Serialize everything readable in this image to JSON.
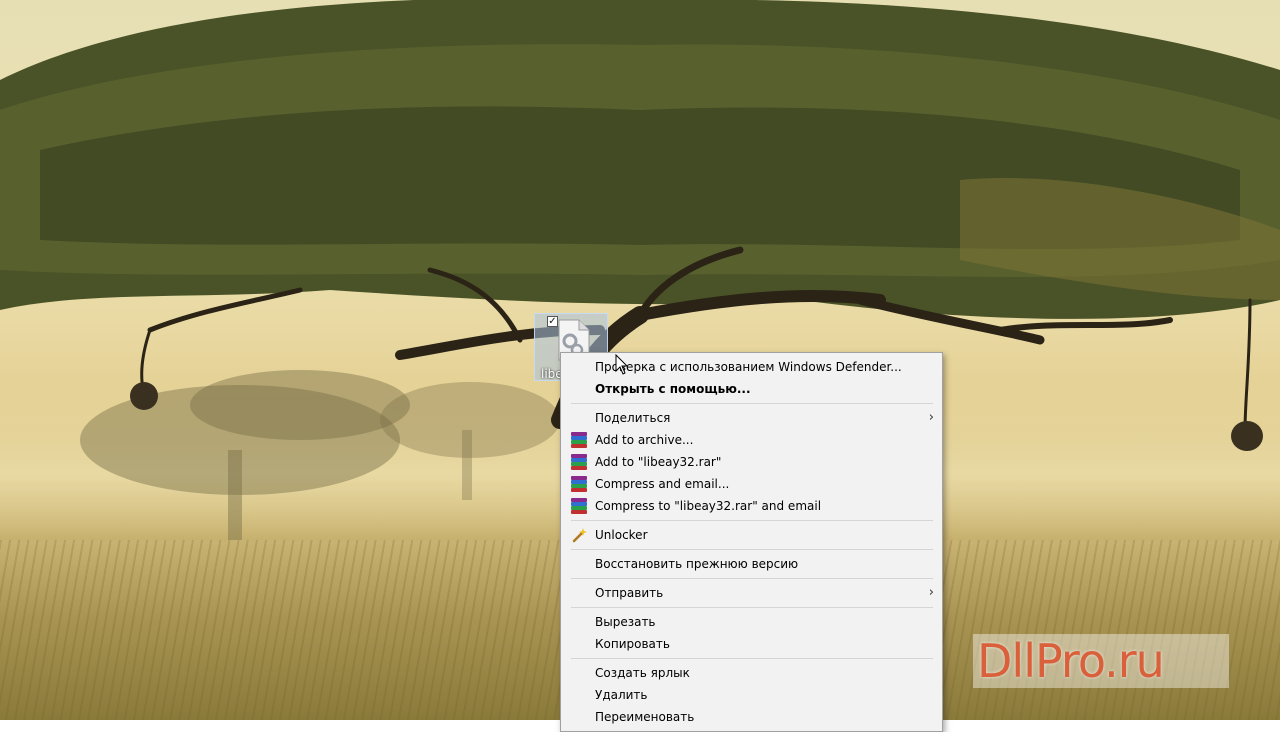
{
  "desktop": {
    "icon": {
      "label": "libe",
      "checked": true
    }
  },
  "context_menu": {
    "items": [
      {
        "label": "Проверка с использованием Windows Defender...",
        "icon": "none"
      },
      {
        "label": "Открыть с помощью...",
        "bold": true
      },
      {
        "label": "Поделиться",
        "submenu": true
      },
      {
        "label": "Add to archive...",
        "icon": "winrar-icon"
      },
      {
        "label": "Add to \"libeay32.rar\"",
        "icon": "winrar-icon"
      },
      {
        "label": "Compress and email...",
        "icon": "winrar-icon"
      },
      {
        "label": "Compress to \"libeay32.rar\" and email",
        "icon": "winrar-icon"
      },
      {
        "label": "Unlocker",
        "icon": "unlocker-wand-icon"
      },
      {
        "label": "Восстановить прежнюю версию"
      },
      {
        "label": "Отправить",
        "submenu": true
      },
      {
        "label": "Вырезать"
      },
      {
        "label": "Копировать"
      },
      {
        "label": "Создать ярлык"
      },
      {
        "label": "Удалить"
      },
      {
        "label": "Переименовать"
      }
    ],
    "submenu_glyph": "›"
  },
  "watermark": {
    "text": "DllPro.ru"
  },
  "colors": {
    "menu_bg": "#f2f2f2",
    "selection": "#aac3e1",
    "watermark": "#d9603a"
  }
}
